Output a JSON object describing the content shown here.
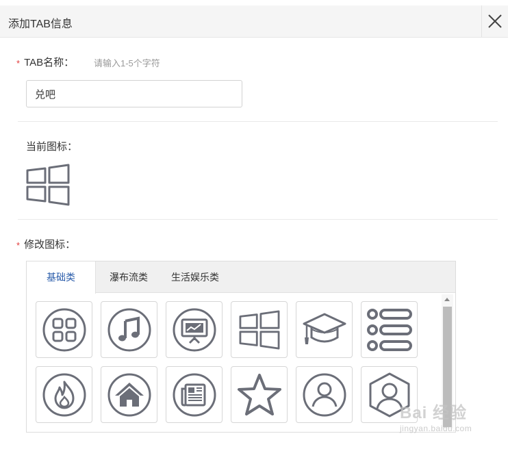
{
  "dialog": {
    "title": "添加TAB信息",
    "close_icon": "close-icon"
  },
  "form": {
    "required_mark": "*",
    "tab_name_label": "TAB名称：",
    "tab_name_hint": "请输入1-5个字符",
    "tab_name_value": "兑吧",
    "current_icon_label": "当前图标：",
    "current_icon": "windows-icon",
    "modify_icon_label": "修改图标："
  },
  "icon_picker": {
    "tabs": [
      {
        "label": "基础类",
        "active": true
      },
      {
        "label": "瀑布流类",
        "active": false
      },
      {
        "label": "生活娱乐类",
        "active": false
      }
    ],
    "icons": [
      "grid-icon",
      "music-icon",
      "presentation-icon",
      "windows-icon",
      "graduation-cap-icon",
      "list-icon",
      "fire-icon",
      "home-icon",
      "newspaper-icon",
      "star-icon",
      "user-icon",
      "user-hexagon-icon"
    ],
    "icon_color": "#6b6e78"
  },
  "watermark": {
    "main": "Bai 经验",
    "sub": "jingyan.baidu.com"
  },
  "colors": {
    "required": "#e23c3c",
    "active_tab": "#2a5caa",
    "hint": "#999999"
  }
}
